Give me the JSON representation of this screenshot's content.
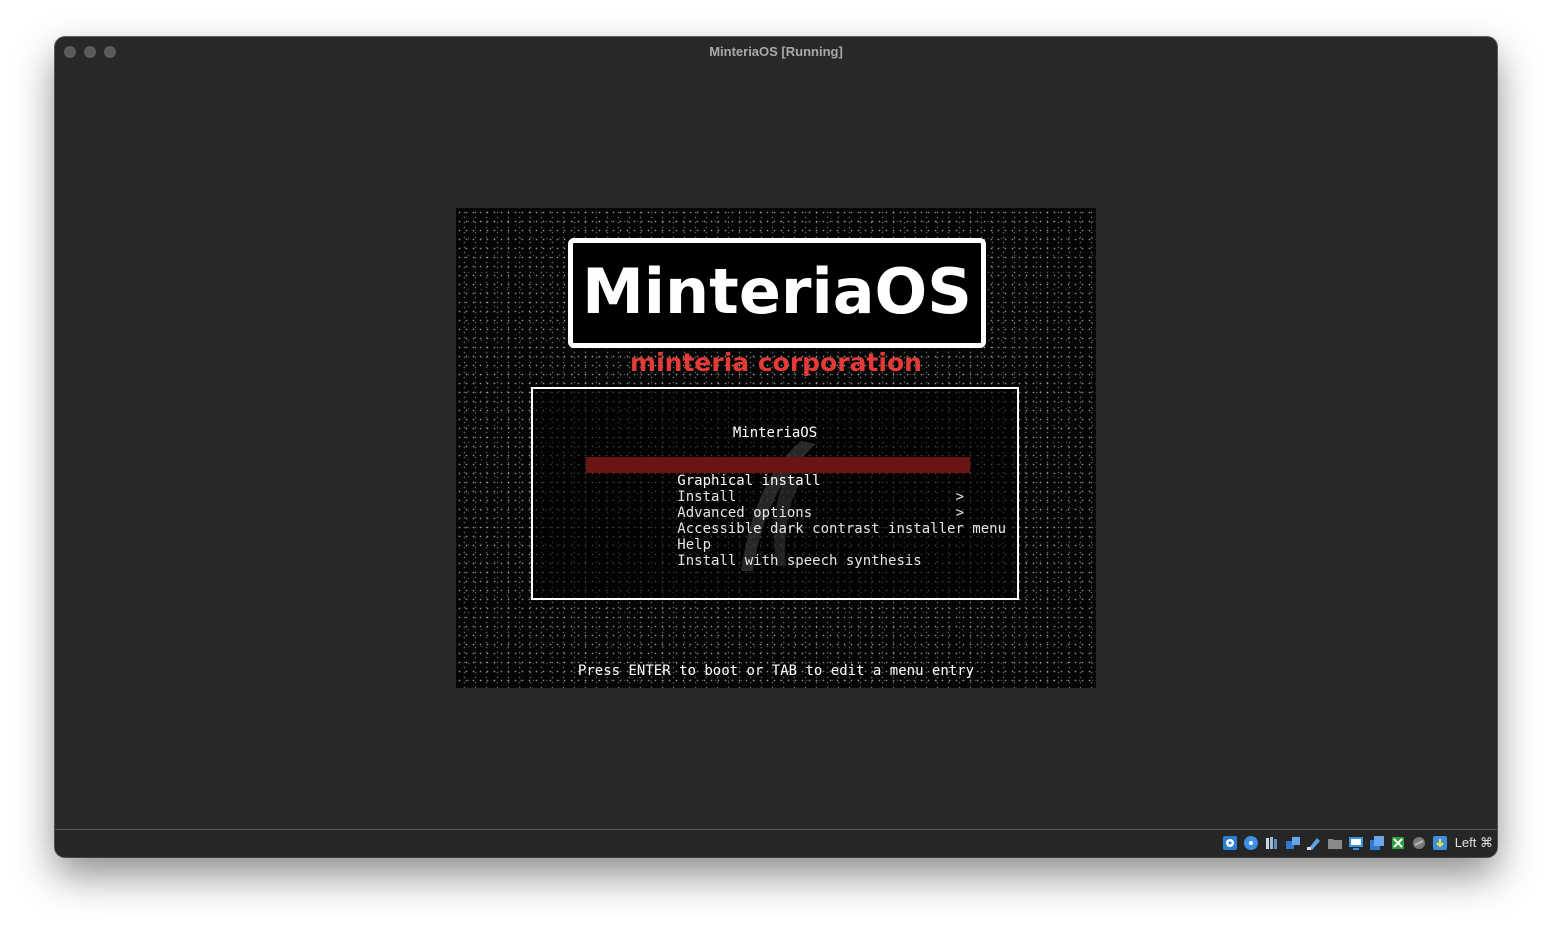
{
  "window": {
    "title": "MinteriaOS [Running]"
  },
  "vm": {
    "logo": {
      "name": "MinteriaOS",
      "subtitle": "minteria corporation"
    },
    "menu": {
      "title": "MinteriaOS",
      "items": [
        {
          "label": "Graphical install",
          "selected": true
        },
        {
          "label": "Install"
        },
        {
          "label": "Advanced options",
          "submenu": ">"
        },
        {
          "label": "Accessible dark contrast installer menu",
          "submenu": ">"
        },
        {
          "label": "Help"
        },
        {
          "label": "Install with speech synthesis"
        }
      ]
    },
    "hint": "Press ENTER to boot or TAB to edit a menu entry"
  },
  "statusbar": {
    "icons": [
      "hard-disk-icon",
      "optical-disk-icon",
      "audio-icon",
      "network-icon",
      "usb-icon",
      "shared-folder-icon",
      "display-icon",
      "screen-capture-icon",
      "cpu-activity-icon",
      "mouse-integration-icon",
      "keyboard-icon"
    ],
    "host_key": "Left ⌘"
  },
  "colors": {
    "selection": "#6b1414",
    "brand_red": "#e53a36"
  }
}
